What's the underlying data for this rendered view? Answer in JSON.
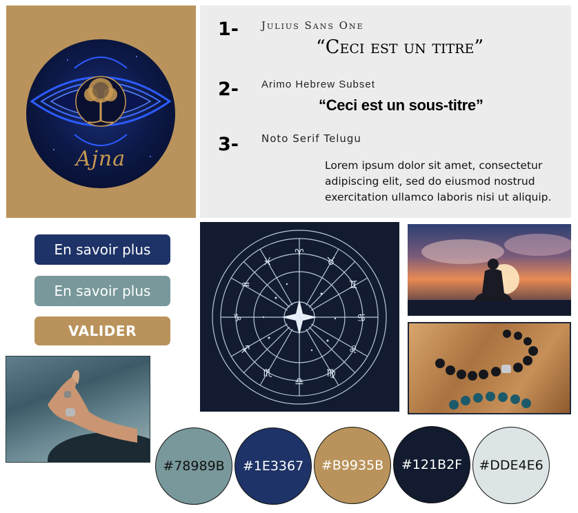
{
  "logo": {
    "word": "Ajna",
    "icon": "tree-of-life-third-eye-icon"
  },
  "typography": [
    {
      "number": "1-",
      "font_name": "Julius Sans One",
      "sample": "“Ceci est un titre”"
    },
    {
      "number": "2-",
      "font_name": "Arimo Hebrew Subset",
      "sample": "“Ceci est un sous-titre”"
    },
    {
      "number": "3-",
      "font_name": "Noto Serif Telugu",
      "sample": "Lorem ipsum dolor sit amet, consectetur adipiscing elit, sed do eiusmod nostrud exercitation ullamco laboris nisi ut aliquip."
    }
  ],
  "buttons": {
    "primary": "En savoir plus",
    "secondary": "En savoir plus",
    "validate": "VALIDER"
  },
  "images": {
    "hand": "meditation-hand-mudra-photo",
    "zodiac": "zodiac-wheel-illustration",
    "sunset": "meditation-silhouette-sunset-photo",
    "beads": "bead-bracelets-photo"
  },
  "palette": [
    {
      "label": "#78989B",
      "color": "#78989b"
    },
    {
      "label": "#1E3367",
      "color": "#1e3367"
    },
    {
      "label": "#B9935B",
      "color": "#b9935b"
    },
    {
      "label": "#121B2F",
      "color": "#121b2f"
    },
    {
      "label": "#DDE4E6",
      "color": "#dde4e6"
    }
  ]
}
